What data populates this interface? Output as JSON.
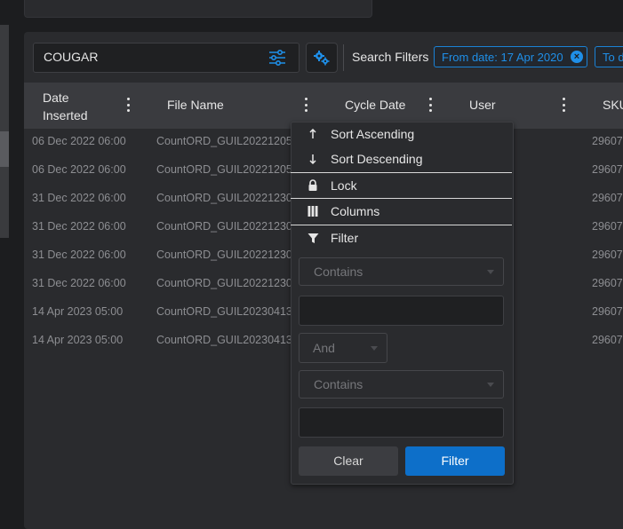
{
  "search": {
    "value": "COUGAR"
  },
  "filters": {
    "label": "Search Filters",
    "chips": [
      "From date: 17 Apr 2020",
      "To d"
    ],
    "chip_close": "×"
  },
  "columns": [
    {
      "label_line1": "Date",
      "label_line2": "Inserted"
    },
    {
      "label": "File Name"
    },
    {
      "label": "Cycle Date"
    },
    {
      "label": "User"
    },
    {
      "label": "SKU"
    }
  ],
  "rows": [
    {
      "date_inserted": "06 Dec 2022 06:00",
      "file_name": "CountORD_GUIL20221205",
      "sku": "29607"
    },
    {
      "date_inserted": "06 Dec 2022 06:00",
      "file_name": "CountORD_GUIL20221205",
      "sku": "29607"
    },
    {
      "date_inserted": "31 Dec 2022 06:00",
      "file_name": "CountORD_GUIL20221230",
      "sku": "29607"
    },
    {
      "date_inserted": "31 Dec 2022 06:00",
      "file_name": "CountORD_GUIL20221230",
      "sku": "29607"
    },
    {
      "date_inserted": "31 Dec 2022 06:00",
      "file_name": "CountORD_GUIL20221230",
      "sku": "29607"
    },
    {
      "date_inserted": "31 Dec 2022 06:00",
      "file_name": "CountORD_GUIL20221230",
      "sku": "29607"
    },
    {
      "date_inserted": "14 Apr 2023 05:00",
      "file_name": "CountORD_GUIL20230413",
      "sku": "29607"
    },
    {
      "date_inserted": "14 Apr 2023 05:00",
      "file_name": "CountORD_GUIL20230413",
      "sku": "29607"
    }
  ],
  "column_menu": {
    "sort_asc": "Sort Ascending",
    "sort_desc": "Sort Descending",
    "lock": "Lock",
    "columns": "Columns",
    "filter": "Filter",
    "condition1": "Contains",
    "operator": "And",
    "condition2": "Contains",
    "clear_label": "Clear",
    "filter_label": "Filter"
  },
  "colors": {
    "accent": "#1f8fe8",
    "primary_button": "#0d6fc9"
  }
}
